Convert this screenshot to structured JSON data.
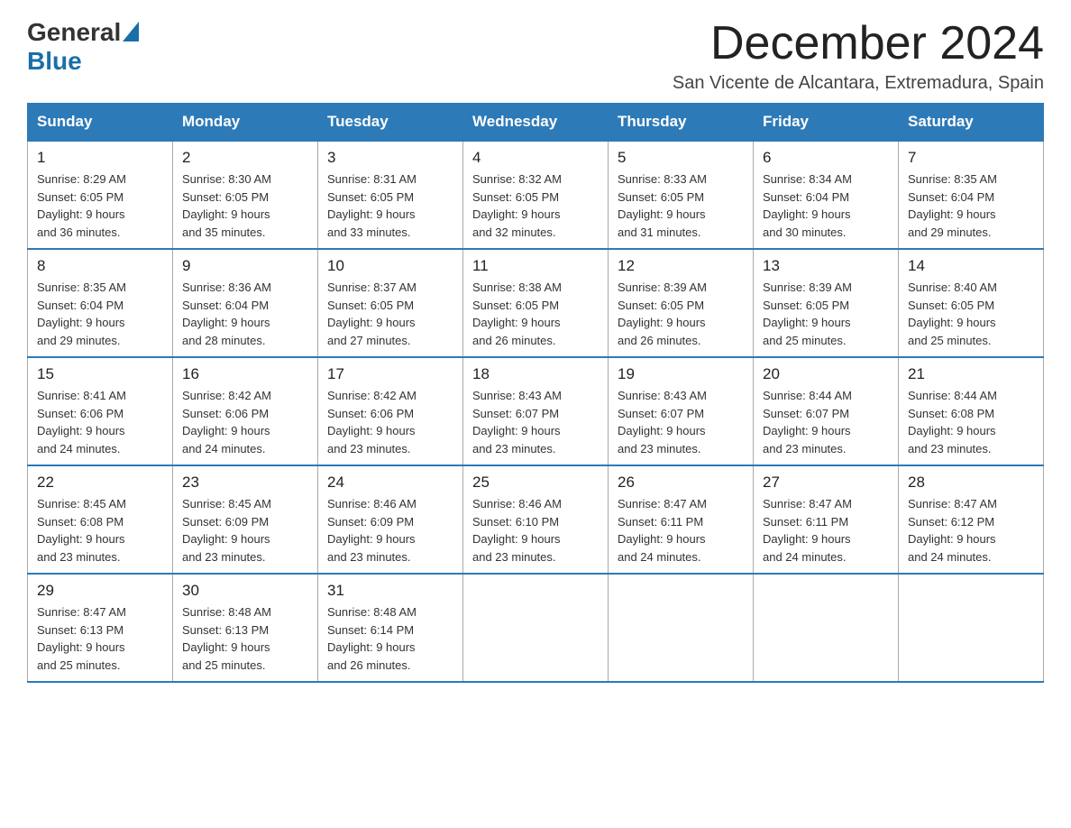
{
  "header": {
    "logo_general": "General",
    "logo_blue": "Blue",
    "month_title": "December 2024",
    "location": "San Vicente de Alcantara, Extremadura, Spain"
  },
  "weekdays": [
    "Sunday",
    "Monday",
    "Tuesday",
    "Wednesday",
    "Thursday",
    "Friday",
    "Saturday"
  ],
  "weeks": [
    [
      {
        "day": "1",
        "sunrise": "Sunrise: 8:29 AM",
        "sunset": "Sunset: 6:05 PM",
        "daylight": "Daylight: 9 hours",
        "minutes": "and 36 minutes."
      },
      {
        "day": "2",
        "sunrise": "Sunrise: 8:30 AM",
        "sunset": "Sunset: 6:05 PM",
        "daylight": "Daylight: 9 hours",
        "minutes": "and 35 minutes."
      },
      {
        "day": "3",
        "sunrise": "Sunrise: 8:31 AM",
        "sunset": "Sunset: 6:05 PM",
        "daylight": "Daylight: 9 hours",
        "minutes": "and 33 minutes."
      },
      {
        "day": "4",
        "sunrise": "Sunrise: 8:32 AM",
        "sunset": "Sunset: 6:05 PM",
        "daylight": "Daylight: 9 hours",
        "minutes": "and 32 minutes."
      },
      {
        "day": "5",
        "sunrise": "Sunrise: 8:33 AM",
        "sunset": "Sunset: 6:05 PM",
        "daylight": "Daylight: 9 hours",
        "minutes": "and 31 minutes."
      },
      {
        "day": "6",
        "sunrise": "Sunrise: 8:34 AM",
        "sunset": "Sunset: 6:04 PM",
        "daylight": "Daylight: 9 hours",
        "minutes": "and 30 minutes."
      },
      {
        "day": "7",
        "sunrise": "Sunrise: 8:35 AM",
        "sunset": "Sunset: 6:04 PM",
        "daylight": "Daylight: 9 hours",
        "minutes": "and 29 minutes."
      }
    ],
    [
      {
        "day": "8",
        "sunrise": "Sunrise: 8:35 AM",
        "sunset": "Sunset: 6:04 PM",
        "daylight": "Daylight: 9 hours",
        "minutes": "and 29 minutes."
      },
      {
        "day": "9",
        "sunrise": "Sunrise: 8:36 AM",
        "sunset": "Sunset: 6:04 PM",
        "daylight": "Daylight: 9 hours",
        "minutes": "and 28 minutes."
      },
      {
        "day": "10",
        "sunrise": "Sunrise: 8:37 AM",
        "sunset": "Sunset: 6:05 PM",
        "daylight": "Daylight: 9 hours",
        "minutes": "and 27 minutes."
      },
      {
        "day": "11",
        "sunrise": "Sunrise: 8:38 AM",
        "sunset": "Sunset: 6:05 PM",
        "daylight": "Daylight: 9 hours",
        "minutes": "and 26 minutes."
      },
      {
        "day": "12",
        "sunrise": "Sunrise: 8:39 AM",
        "sunset": "Sunset: 6:05 PM",
        "daylight": "Daylight: 9 hours",
        "minutes": "and 26 minutes."
      },
      {
        "day": "13",
        "sunrise": "Sunrise: 8:39 AM",
        "sunset": "Sunset: 6:05 PM",
        "daylight": "Daylight: 9 hours",
        "minutes": "and 25 minutes."
      },
      {
        "day": "14",
        "sunrise": "Sunrise: 8:40 AM",
        "sunset": "Sunset: 6:05 PM",
        "daylight": "Daylight: 9 hours",
        "minutes": "and 25 minutes."
      }
    ],
    [
      {
        "day": "15",
        "sunrise": "Sunrise: 8:41 AM",
        "sunset": "Sunset: 6:06 PM",
        "daylight": "Daylight: 9 hours",
        "minutes": "and 24 minutes."
      },
      {
        "day": "16",
        "sunrise": "Sunrise: 8:42 AM",
        "sunset": "Sunset: 6:06 PM",
        "daylight": "Daylight: 9 hours",
        "minutes": "and 24 minutes."
      },
      {
        "day": "17",
        "sunrise": "Sunrise: 8:42 AM",
        "sunset": "Sunset: 6:06 PM",
        "daylight": "Daylight: 9 hours",
        "minutes": "and 23 minutes."
      },
      {
        "day": "18",
        "sunrise": "Sunrise: 8:43 AM",
        "sunset": "Sunset: 6:07 PM",
        "daylight": "Daylight: 9 hours",
        "minutes": "and 23 minutes."
      },
      {
        "day": "19",
        "sunrise": "Sunrise: 8:43 AM",
        "sunset": "Sunset: 6:07 PM",
        "daylight": "Daylight: 9 hours",
        "minutes": "and 23 minutes."
      },
      {
        "day": "20",
        "sunrise": "Sunrise: 8:44 AM",
        "sunset": "Sunset: 6:07 PM",
        "daylight": "Daylight: 9 hours",
        "minutes": "and 23 minutes."
      },
      {
        "day": "21",
        "sunrise": "Sunrise: 8:44 AM",
        "sunset": "Sunset: 6:08 PM",
        "daylight": "Daylight: 9 hours",
        "minutes": "and 23 minutes."
      }
    ],
    [
      {
        "day": "22",
        "sunrise": "Sunrise: 8:45 AM",
        "sunset": "Sunset: 6:08 PM",
        "daylight": "Daylight: 9 hours",
        "minutes": "and 23 minutes."
      },
      {
        "day": "23",
        "sunrise": "Sunrise: 8:45 AM",
        "sunset": "Sunset: 6:09 PM",
        "daylight": "Daylight: 9 hours",
        "minutes": "and 23 minutes."
      },
      {
        "day": "24",
        "sunrise": "Sunrise: 8:46 AM",
        "sunset": "Sunset: 6:09 PM",
        "daylight": "Daylight: 9 hours",
        "minutes": "and 23 minutes."
      },
      {
        "day": "25",
        "sunrise": "Sunrise: 8:46 AM",
        "sunset": "Sunset: 6:10 PM",
        "daylight": "Daylight: 9 hours",
        "minutes": "and 23 minutes."
      },
      {
        "day": "26",
        "sunrise": "Sunrise: 8:47 AM",
        "sunset": "Sunset: 6:11 PM",
        "daylight": "Daylight: 9 hours",
        "minutes": "and 24 minutes."
      },
      {
        "day": "27",
        "sunrise": "Sunrise: 8:47 AM",
        "sunset": "Sunset: 6:11 PM",
        "daylight": "Daylight: 9 hours",
        "minutes": "and 24 minutes."
      },
      {
        "day": "28",
        "sunrise": "Sunrise: 8:47 AM",
        "sunset": "Sunset: 6:12 PM",
        "daylight": "Daylight: 9 hours",
        "minutes": "and 24 minutes."
      }
    ],
    [
      {
        "day": "29",
        "sunrise": "Sunrise: 8:47 AM",
        "sunset": "Sunset: 6:13 PM",
        "daylight": "Daylight: 9 hours",
        "minutes": "and 25 minutes."
      },
      {
        "day": "30",
        "sunrise": "Sunrise: 8:48 AM",
        "sunset": "Sunset: 6:13 PM",
        "daylight": "Daylight: 9 hours",
        "minutes": "and 25 minutes."
      },
      {
        "day": "31",
        "sunrise": "Sunrise: 8:48 AM",
        "sunset": "Sunset: 6:14 PM",
        "daylight": "Daylight: 9 hours",
        "minutes": "and 26 minutes."
      },
      null,
      null,
      null,
      null
    ]
  ]
}
